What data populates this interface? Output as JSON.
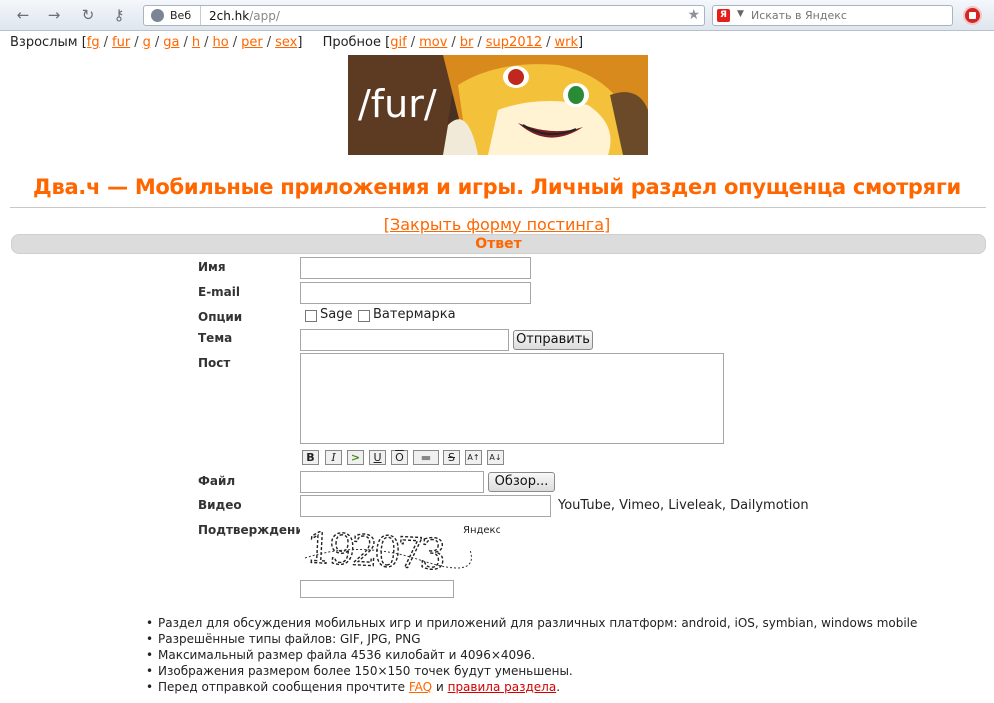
{
  "browser": {
    "search_engine_label": "Веб",
    "url_host": "2ch.hk",
    "url_path": "/app/",
    "search_placeholder": "Искать в Яндекс"
  },
  "nav": {
    "adult_label": "Взрослым",
    "adult_boards": [
      "fg",
      "fur",
      "g",
      "ga",
      "h",
      "ho",
      "per",
      "sex"
    ],
    "trial_label": "Пробное",
    "trial_boards": [
      "gif",
      "mov",
      "br",
      "sup2012",
      "wrk"
    ]
  },
  "banner": {
    "text": "/fur/"
  },
  "page_title": "Два.ч — Мобильные приложения и игры. Личный раздел опущенца смотряги",
  "close_form_link": "[Закрыть форму постинга]",
  "reply_header": "Ответ",
  "form": {
    "name_label": "Имя",
    "email_label": "E-mail",
    "options_label": "Опции",
    "sage_label": "Sage",
    "watermark_label": "Ватермарка",
    "subject_label": "Тема",
    "submit_label": "Отправить",
    "post_label": "Пост",
    "markup_buttons": [
      "B",
      "I",
      ">",
      "U",
      "O",
      "▬",
      "S",
      "A↑",
      "A↓"
    ],
    "file_label": "Файл",
    "browse_label": "Обзор...",
    "video_label": "Видео",
    "video_hint": "YouTube, Vimeo, Liveleak, Dailymotion",
    "captcha_label": "Подтверждение",
    "captcha_brand": "Яндекс",
    "captcha_text": "192073"
  },
  "rules": {
    "items": [
      "Раздел для обсуждения мобильных игр и приложений для различных платформ: android, iOS, symbian, windows mobile",
      "Разрешённые типы файлов: GIF, JPG, PNG",
      "Максимальный размер файла 4536 килобайт и 4096×4096.",
      "Изображения размером более 150×150 точек будут уменьшены."
    ],
    "last_prefix": "Перед отправкой сообщения прочтите",
    "faq_link": "FAQ",
    "and_word": "и",
    "rules_link": "правила раздела",
    "last_suffix": "."
  }
}
